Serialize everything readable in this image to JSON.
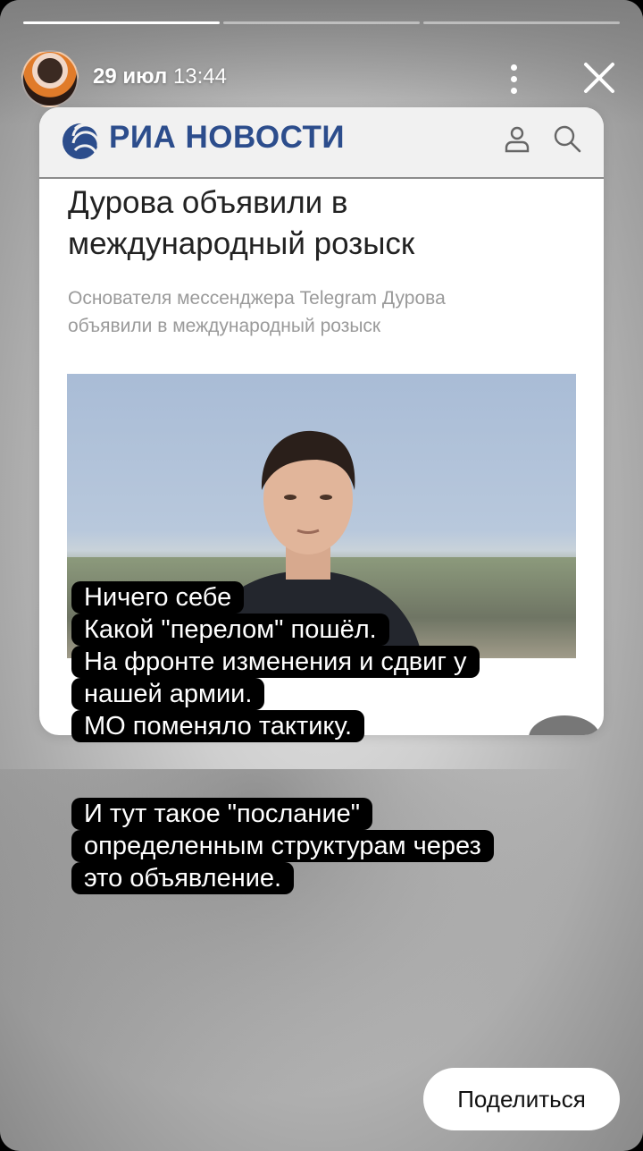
{
  "story": {
    "date": "29 июл",
    "time": "13:44",
    "share_label": "Поделиться"
  },
  "article": {
    "brand": "РИА НОВОСТИ",
    "headline_line1": "Дурова объявили в",
    "headline_line2": "международный розыск",
    "subheadline_line1": "Основателя мессенджера Telegram Дурова",
    "subheadline_line2": "объявили в международный розыск"
  },
  "captions": {
    "block1": [
      "Ничего себе",
      "Какой \"перелом\" пошёл.",
      "На фронте изменения и сдвиг у",
      "нашей армии.",
      "МО поменяло тактику."
    ],
    "block2": [
      "И тут такое \"послание\"",
      "определенным структурам через",
      "это объявление."
    ]
  },
  "icons": {
    "more": "more-vertical-icon",
    "close": "close-icon",
    "logo": "ria-logo-icon",
    "user": "user-icon",
    "search": "search-icon"
  }
}
